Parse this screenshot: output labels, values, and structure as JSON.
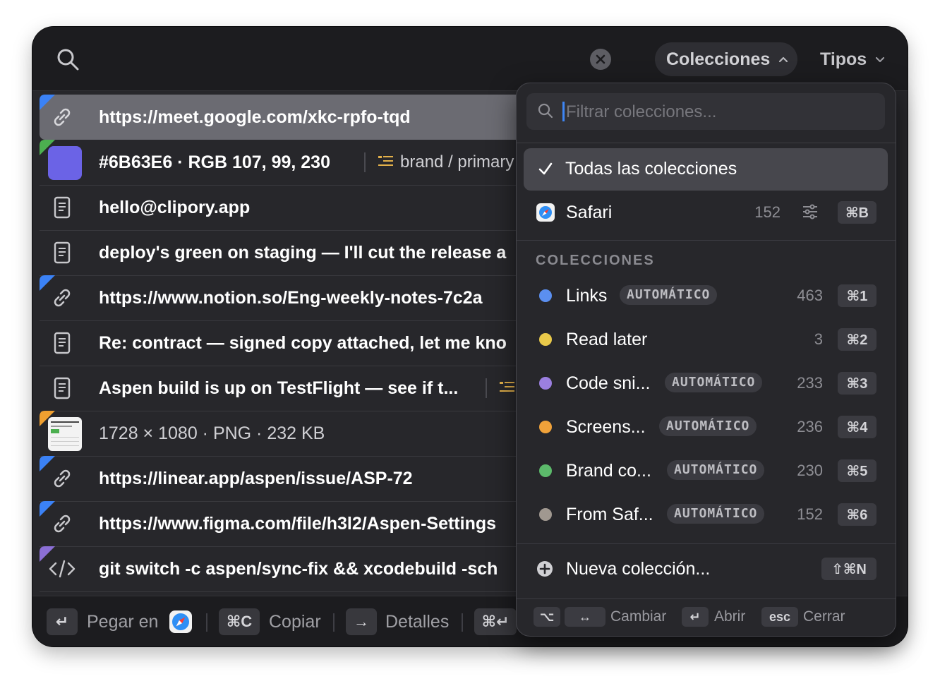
{
  "search": {
    "placeholder": ""
  },
  "header": {
    "collections_label": "Colecciones",
    "types_label": "Tipos"
  },
  "rows": [
    {
      "text": "https://meet.google.com/xkc-rpfo-tqd",
      "icon": "link-icon",
      "corner": "#3b82f6"
    },
    {
      "text": "#6B63E6 · RGB 107, 99, 230",
      "icon": "color-swatch",
      "swatch": "#6B63E6",
      "tag": "brand / primary",
      "corner": "#4caf50"
    },
    {
      "text": "hello@clipory.app",
      "icon": "document-icon"
    },
    {
      "text": "deploy's green on staging — I'll cut the release a",
      "icon": "document-icon"
    },
    {
      "text": "https://www.notion.so/Eng-weekly-notes-7c2a",
      "icon": "link-icon",
      "corner": "#3b82f6"
    },
    {
      "text": "Re: contract — signed copy attached, let me kno",
      "icon": "document-icon"
    },
    {
      "text": "Aspen build is up on TestFlight — see if t...",
      "icon": "document-icon"
    },
    {
      "text": "1728 × 1080 · PNG · 232 KB",
      "icon": "image-thumbnail",
      "corner": "#f0a030"
    },
    {
      "text": "https://linear.app/aspen/issue/ASP-72",
      "icon": "link-icon",
      "corner": "#3b82f6"
    },
    {
      "text": "https://www.figma.com/file/h3l2/Aspen-Settings",
      "icon": "link-icon",
      "corner": "#3b82f6"
    },
    {
      "text": "git switch -c aspen/sync-fix && xcodebuild -sch",
      "icon": "code-icon",
      "corner": "#8b6fd6"
    }
  ],
  "footer": {
    "paste_key": "↵",
    "paste_label": "Pegar en",
    "copy_key": "⌘C",
    "copy_label": "Copiar",
    "details_key": "→",
    "details_label": "Detalles",
    "more_key": "⌘↵"
  },
  "dropdown": {
    "filter_placeholder": "Filtrar colecciones...",
    "all_label": "Todas las colecciones",
    "safari": {
      "label": "Safari",
      "count": "152",
      "shortcut": "⌘B"
    },
    "section_title": "COLECCIONES",
    "collections": [
      {
        "label": "Links",
        "badge": "AUTOMÁTICO",
        "count": "463",
        "shortcut": "⌘1",
        "color": "#5b8ff0"
      },
      {
        "label": "Read later",
        "badge": "",
        "count": "3",
        "shortcut": "⌘2",
        "color": "#e9c94a"
      },
      {
        "label": "Code sni...",
        "badge": "AUTOMÁTICO",
        "count": "233",
        "shortcut": "⌘3",
        "color": "#9b7fe0"
      },
      {
        "label": "Screens...",
        "badge": "AUTOMÁTICO",
        "count": "236",
        "shortcut": "⌘4",
        "color": "#f0a23a"
      },
      {
        "label": "Brand co...",
        "badge": "AUTOMÁTICO",
        "count": "230",
        "shortcut": "⌘5",
        "color": "#5cba6b"
      },
      {
        "label": "From Saf...",
        "badge": "AUTOMÁTICO",
        "count": "152",
        "shortcut": "⌘6",
        "color": "#a09890"
      }
    ],
    "new_collection": {
      "label": "Nueva colección...",
      "shortcut": "⇧⌘N"
    },
    "footer": {
      "opt_key": "⌥",
      "arrows_key": "↔",
      "switch_label": "Cambiar",
      "open_key": "↵",
      "open_label": "Abrir",
      "esc_key": "esc",
      "close_label": "Cerrar"
    }
  }
}
